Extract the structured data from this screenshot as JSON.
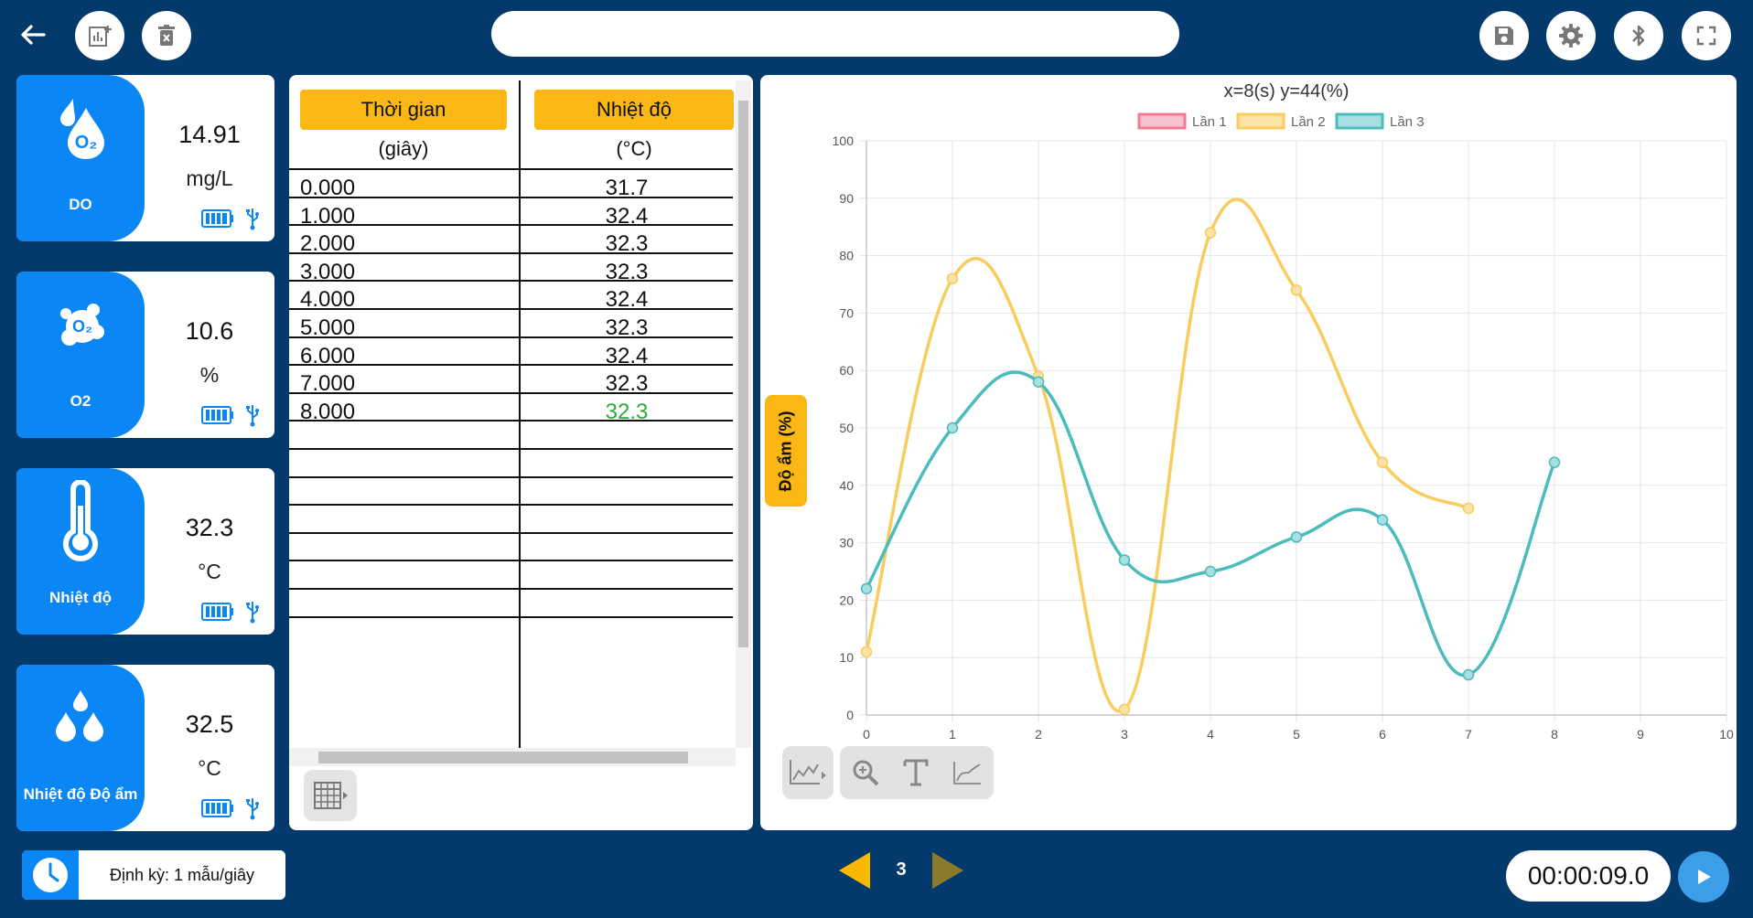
{
  "app": {
    "title_value": "",
    "accent_color": "#0b86f5",
    "header_color": "#fbb714",
    "background_color": "#043a6b"
  },
  "toolbar": {
    "icons": [
      "back-arrow-icon",
      "add-chart-icon",
      "delete-icon",
      "save-icon",
      "settings-icon",
      "bluetooth-icon",
      "fullscreen-icon"
    ]
  },
  "sensors": [
    {
      "name": "DO",
      "value": "14.91",
      "unit": "mg/L",
      "icon": "water-drop-o2-icon"
    },
    {
      "name": "O2",
      "value": "10.6",
      "unit": "%",
      "icon": "o2-bubble-icon"
    },
    {
      "name": "Nhiệt độ",
      "value": "32.3",
      "unit": "°C",
      "icon": "thermometer-icon"
    },
    {
      "name": "Nhiệt độ Độ ẩm",
      "value": "32.5",
      "unit": "°C",
      "icon": "humidity-drops-icon"
    }
  ],
  "table": {
    "col1_header": "Thời gian",
    "col1_unit": "(giây)",
    "col2_header": "Nhiệt độ",
    "col2_unit": "(°C)",
    "rows": [
      {
        "t": "0.000",
        "v": "31.7"
      },
      {
        "t": "1.000",
        "v": "32.4"
      },
      {
        "t": "2.000",
        "v": "32.3"
      },
      {
        "t": "3.000",
        "v": "32.3"
      },
      {
        "t": "4.000",
        "v": "32.4"
      },
      {
        "t": "5.000",
        "v": "32.3"
      },
      {
        "t": "6.000",
        "v": "32.4"
      },
      {
        "t": "7.000",
        "v": "32.3"
      },
      {
        "t": "8.000",
        "v": "32.3"
      }
    ],
    "empty_rows": 8
  },
  "chart_data": {
    "type": "line",
    "title": "x=8(s) y=44(%)",
    "ylabel": "Độ ẩm (%)",
    "xunit": "(s)",
    "xlim": [
      0,
      10
    ],
    "ylim": [
      0,
      100
    ],
    "x_ticks": [
      "0",
      "1",
      "2",
      "3",
      "4",
      "5",
      "6",
      "7",
      "8",
      "9",
      "10"
    ],
    "y_ticks": [
      "0",
      "10",
      "20",
      "30",
      "40",
      "50",
      "60",
      "70",
      "80",
      "90",
      "100"
    ],
    "grid": true,
    "legend_position": "top-center",
    "series": [
      {
        "name": "Lần 1",
        "color": "#f07b93",
        "fill": "#f9c2cf",
        "x": [],
        "values": []
      },
      {
        "name": "Lần 2",
        "color": "#f8cd5e",
        "fill": "#fbe3a6",
        "x": [
          0,
          1,
          2,
          3,
          4,
          5,
          6,
          7
        ],
        "values": [
          11,
          76,
          59,
          1,
          84,
          74,
          44,
          36
        ]
      },
      {
        "name": "Lần 3",
        "color": "#4bbcbd",
        "fill": "#a8dfe0",
        "x": [
          0,
          1,
          2,
          3,
          4,
          5,
          6,
          7,
          8
        ],
        "values": [
          22,
          50,
          58,
          27,
          25,
          31,
          34,
          7,
          44
        ]
      }
    ]
  },
  "bottom": {
    "interval_label": "Định kỳ: 1 mẫu/giây",
    "page_number": "3",
    "timer": "00:00:09.0"
  }
}
